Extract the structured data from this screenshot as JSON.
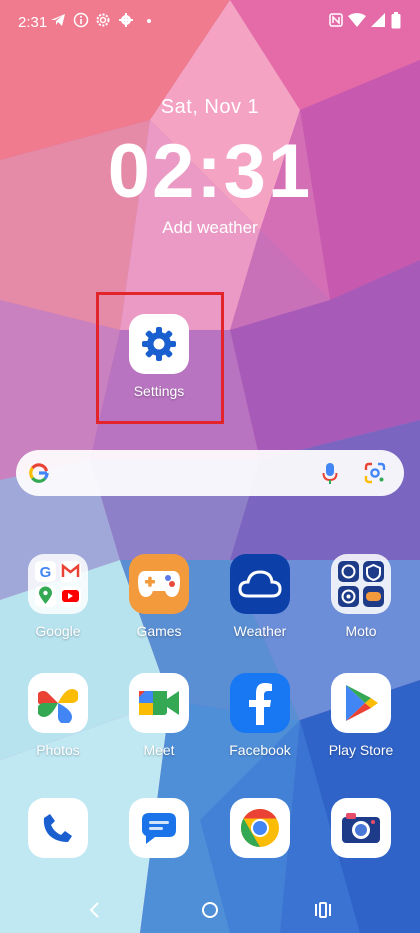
{
  "status_bar": {
    "time": "2:31"
  },
  "lockscreen": {
    "date": "Sat, Nov 1",
    "clock": "02:31",
    "weather_prompt": "Add weather"
  },
  "shortcut": {
    "label": "Settings"
  },
  "apps_row1": [
    {
      "label": "Google"
    },
    {
      "label": "Games"
    },
    {
      "label": "Weather"
    },
    {
      "label": "Moto"
    }
  ],
  "apps_row2": [
    {
      "label": "Photos"
    },
    {
      "label": "Meet"
    },
    {
      "label": "Facebook"
    },
    {
      "label": "Play Store"
    }
  ],
  "colors": {
    "highlight": "#e3242b",
    "settings_blue": "#1a5fcf",
    "weather_tile": "#0d3fa8",
    "facebook_blue": "#1877f2",
    "games_orange": "#f39a3c"
  }
}
